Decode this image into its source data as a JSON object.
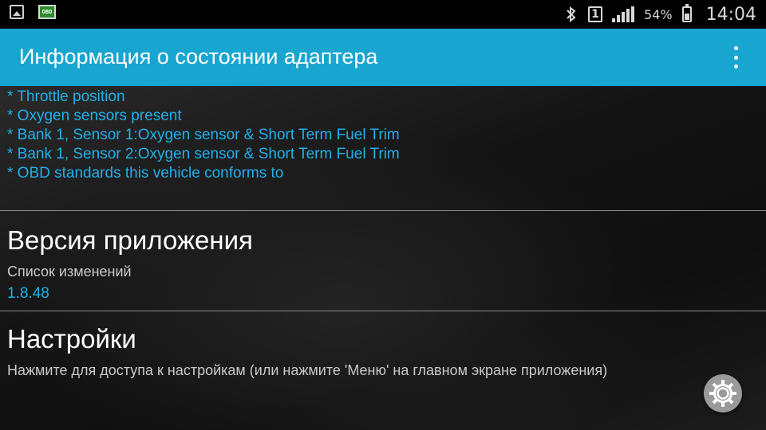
{
  "status_bar": {
    "icons_left": [
      "gallery-icon",
      "obd-app-icon"
    ],
    "obd_badge_text": "OBD",
    "bluetooth_icon": "bluetooth-icon",
    "sim_slot": "1",
    "signal_icon": "signal-icon",
    "battery_percent": "54%",
    "battery_level": 0.54,
    "time": "14:04"
  },
  "app_bar": {
    "title": "Информация о состоянии адаптера",
    "menu_icon": "overflow-menu-icon"
  },
  "supported_pids": [
    "* Throttle position",
    "* Oxygen sensors present",
    "* Bank 1, Sensor 1:Oxygen sensor & Short Term Fuel Trim",
    "* Bank 1, Sensor 2:Oxygen sensor & Short Term Fuel Trim",
    "* OBD standards this vehicle conforms to"
  ],
  "app_version": {
    "title": "Версия приложения",
    "summary": "Список изменений",
    "value": "1.8.48"
  },
  "settings": {
    "title": "Настройки",
    "summary": "Нажмите для доступа к настройкам (или нажмите 'Меню' на главном экране приложения)"
  },
  "colors": {
    "app_bar": "#18a5d0",
    "accent_text": "#1fb0ea",
    "status_bar": "#000000"
  }
}
